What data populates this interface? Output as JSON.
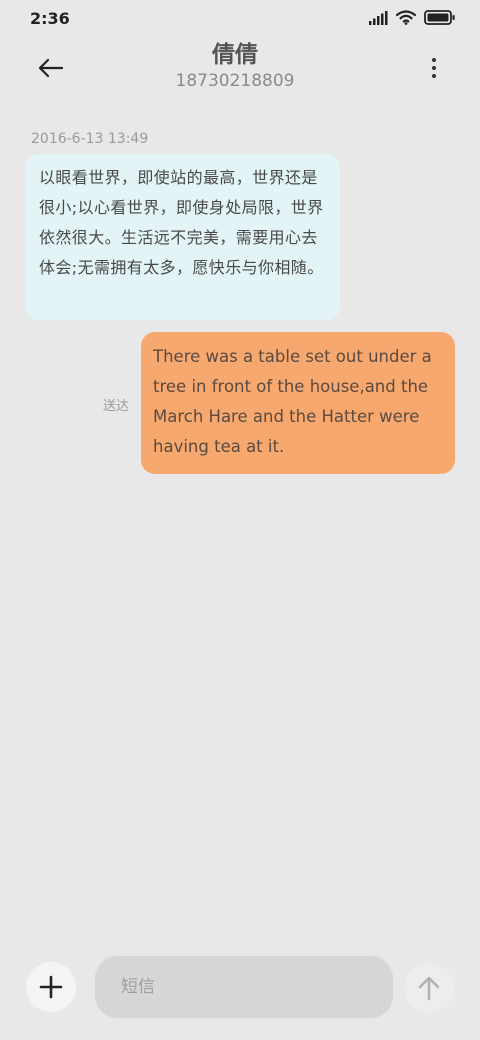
{
  "status_bar": {
    "time": "2:36",
    "icons": [
      "signal-icon",
      "wifi-icon",
      "battery-icon"
    ]
  },
  "header": {
    "contact_name": "倩倩",
    "contact_number": "18730218809",
    "back_icon": "arrow-left-icon",
    "menu_icon": "more-vertical-icon"
  },
  "conversation": {
    "timestamp": "2016-6-13 13:49",
    "incoming_message": "以眼看世界，即使站的最高，世界还是很小;以心看世界，即使身处局限，世界依然很大。生活远不完美，需要用心去体会;无需拥有太多，愿快乐与你相随。",
    "outgoing_message": "There was a table set out under a tree in front of the house,and the March Hare and the Hatter were having tea at it.",
    "outgoing_status": "送达"
  },
  "composer": {
    "placeholder": "短信",
    "value": "",
    "add_icon": "plus-icon",
    "send_icon": "arrow-up-icon"
  },
  "colors": {
    "background": "#e8e8e8",
    "incoming_bubble": "#e2f4f6",
    "outgoing_bubble": "#f7a86e"
  }
}
